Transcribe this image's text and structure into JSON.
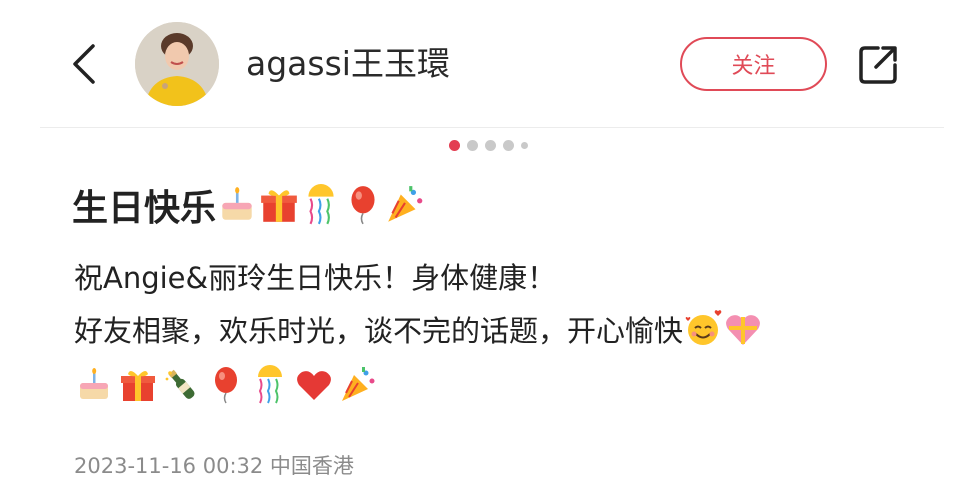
{
  "header": {
    "username": "agassi王玉環",
    "follow_label": "关注"
  },
  "pager": {
    "count": 5,
    "active_index": 0
  },
  "post": {
    "title": "生日快乐",
    "title_emojis": [
      "cake-icon",
      "gift-icon",
      "confetti-ball-icon",
      "balloon-icon",
      "party-popper-icon"
    ],
    "line1": "祝Angie&丽玲生日快乐！身体健康！",
    "line2": "好友相聚，欢乐时光，谈不完的话题，开心愉快",
    "line2_emojis": [
      "smiling-hearts-icon",
      "heart-gift-icon"
    ],
    "line3_emojis": [
      "cake-icon",
      "gift-icon",
      "champagne-icon",
      "balloon-icon",
      "confetti-ball-icon",
      "red-heart-icon",
      "party-popper-icon"
    ],
    "timestamp": "2023-11-16 00:32 中国香港"
  },
  "colors": {
    "accent": "#e04a57",
    "active_dot": "#e33e52",
    "muted_text": "#8b8b8b"
  }
}
